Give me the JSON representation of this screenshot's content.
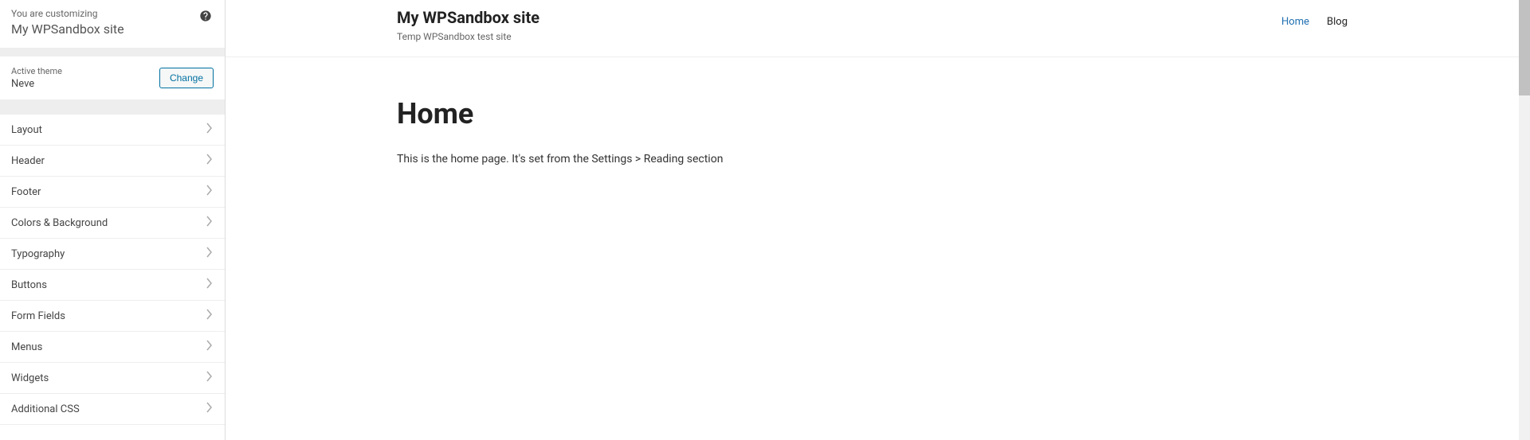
{
  "sidebar": {
    "customizing_label": "You are customizing",
    "site_name": "My WPSandbox site",
    "active_theme_label": "Active theme",
    "active_theme_name": "Neve",
    "change_button": "Change",
    "menu_items": [
      "Layout",
      "Header",
      "Footer",
      "Colors & Background",
      "Typography",
      "Buttons",
      "Form Fields",
      "Menus",
      "Widgets",
      "Additional CSS"
    ]
  },
  "preview": {
    "site_title": "My WPSandbox site",
    "site_tagline": "Temp WPSandbox test site",
    "nav": [
      {
        "label": "Home",
        "active": true
      },
      {
        "label": "Blog",
        "active": false
      }
    ],
    "page_title": "Home",
    "page_body": "This is the home page. It's set from the Settings > Reading section"
  }
}
